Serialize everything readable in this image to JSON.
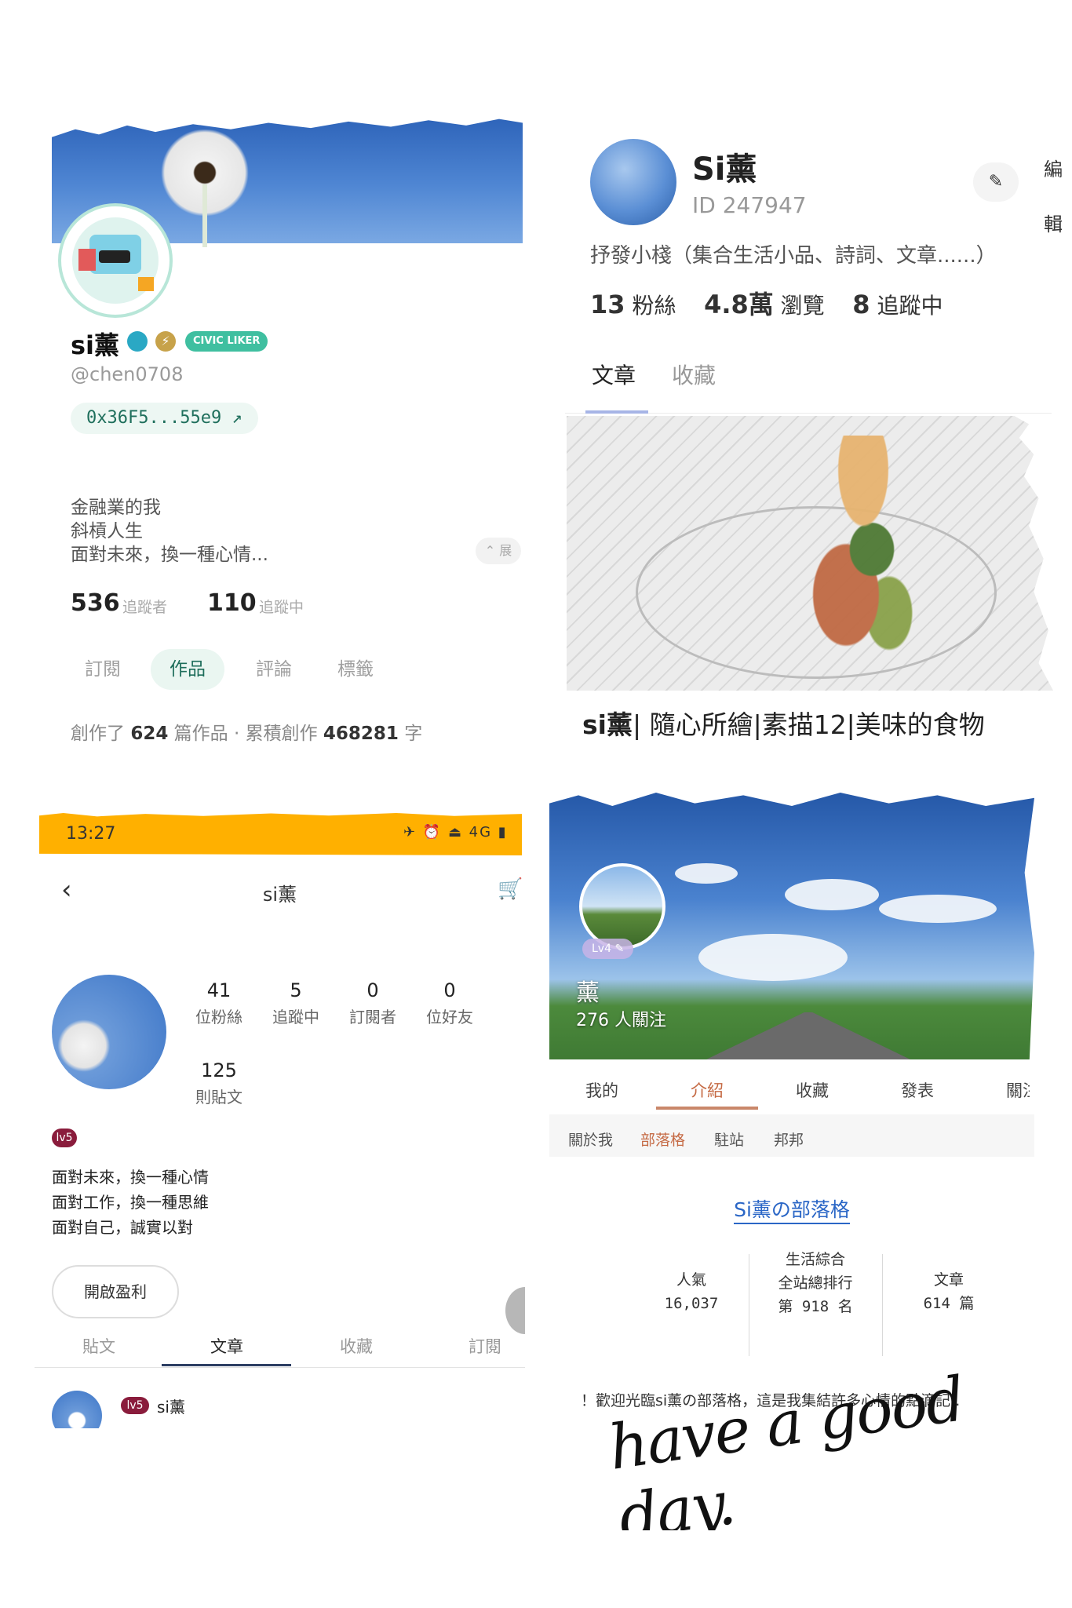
{
  "panelA": {
    "name": "si薰",
    "civic_label": "CIVIC LIKER",
    "handle": "@chen0708",
    "wallet": "0x36F5...55e9 ↗",
    "bio": [
      "金融業的我",
      "斜槓人生",
      "面對未來，換一種心情..."
    ],
    "expand_label": "⌃ 展",
    "followers_count": "536",
    "followers_label": "追蹤者",
    "following_count": "110",
    "following_label": "追蹤中",
    "tabs": [
      "訂閱",
      "作品",
      "評論",
      "標籤"
    ],
    "works_prefix": "創作了",
    "works_count": "624",
    "works_mid": "篇作品 · 累積創作",
    "chars_count": "468281",
    "works_suffix": "字"
  },
  "panelB": {
    "name": "Si薰",
    "uid": "ID 247947",
    "edit_icon": "✎",
    "side_chars": [
      "編",
      "輯"
    ],
    "desc": "抒發小棧（集合生活小品、詩詞、文章......）",
    "fans_count": "13",
    "fans_label": "粉絲",
    "views_count": "4.8萬",
    "views_label": "瀏覽",
    "following_count": "8",
    "following_label": "追蹤中",
    "tabs": [
      "文章",
      "收藏"
    ],
    "article_title_bold": "si薰",
    "article_title_rest": "| 隨心所繪|素描12|美味的食物"
  },
  "panelC": {
    "time": "13:27",
    "status_icons": "✈ ⏰ ⏏ 4G ▮",
    "title": "si薰",
    "back_icon": "‹",
    "cart_icon": "🛒",
    "stats": [
      {
        "n": "41",
        "l": "位粉絲"
      },
      {
        "n": "5",
        "l": "追蹤中"
      },
      {
        "n": "0",
        "l": "訂閱者"
      },
      {
        "n": "0",
        "l": "位好友"
      },
      {
        "n": "125",
        "l": "則貼文"
      }
    ],
    "level": "lv5",
    "bio": [
      "面對未來，換一種心情",
      "面對工作，換一種思維",
      "面對自己，誠實以對"
    ],
    "monetize_button": "開啟盈利",
    "tabs": [
      "貼文",
      "文章",
      "收藏",
      "訂閱"
    ],
    "post_level": "lv5",
    "post_name": "si薰"
  },
  "panelD": {
    "level": "Lv4 ✎",
    "name": "薰",
    "followers": "276 人關注",
    "tabs": [
      "我的",
      "介紹",
      "收藏",
      "發表",
      "關注"
    ],
    "subnav": [
      "關於我",
      "部落格",
      "駐站",
      "邦邦"
    ],
    "blog_title": "Si薰の部落格",
    "stats": [
      {
        "l1": "人氣",
        "l2": "16,037",
        "l3": ""
      },
      {
        "l1": "生活綜合",
        "l2": "全站總排行",
        "l3": "第 918 名"
      },
      {
        "l1": "文章",
        "l2": "614 篇",
        "l3": ""
      }
    ],
    "welcome": "！歡迎光臨si薰の部落格，這是我集結許多心情的點滴記..",
    "signature": "have a good day."
  }
}
